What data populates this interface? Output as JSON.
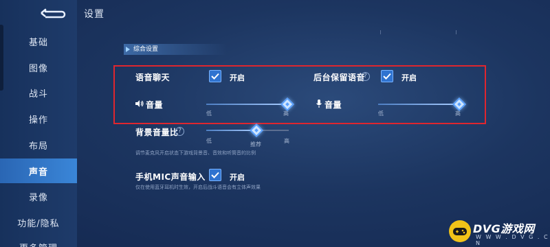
{
  "page": {
    "title": "设置"
  },
  "sidebar": {
    "items": [
      {
        "label": "基础"
      },
      {
        "label": "图像"
      },
      {
        "label": "战斗"
      },
      {
        "label": "操作"
      },
      {
        "label": "布局"
      },
      {
        "label": "声音",
        "active": true
      },
      {
        "label": "录像"
      },
      {
        "label": "功能/隐私"
      },
      {
        "label": "更多管理"
      }
    ]
  },
  "section": {
    "label": "综合设置"
  },
  "voice_chat": {
    "label": "语音聊天",
    "checked": true,
    "on_label": "开启",
    "volume": {
      "label": "音量",
      "low": "低",
      "high": "高",
      "value_fraction": 1.0
    }
  },
  "background_voice": {
    "label": "后台保留语音",
    "checked": true,
    "on_label": "开启",
    "volume": {
      "label": "音量",
      "low": "低",
      "high": "高",
      "value_fraction": 1.0
    }
  },
  "bg_volume_ratio": {
    "label": "背景音量比",
    "low": "低",
    "recommended": "推荐",
    "high": "高",
    "value_fraction": 0.6,
    "description": "调节麦克风开启状态下游戏背景音、音效和听筒音的比例"
  },
  "mic_input": {
    "label": "手机MIC声音输入",
    "checked": true,
    "on_label": "开启",
    "description": "仅在使用蓝牙耳机时生效，开启后战斗语音会有立体声效果"
  },
  "watermark": {
    "brand": "DVG游戏网",
    "url": "W W W . D V G . C N"
  },
  "colors": {
    "accent": "#2f73d0",
    "highlight_box": "#e0262e",
    "active_tab": "#3a86d8"
  }
}
